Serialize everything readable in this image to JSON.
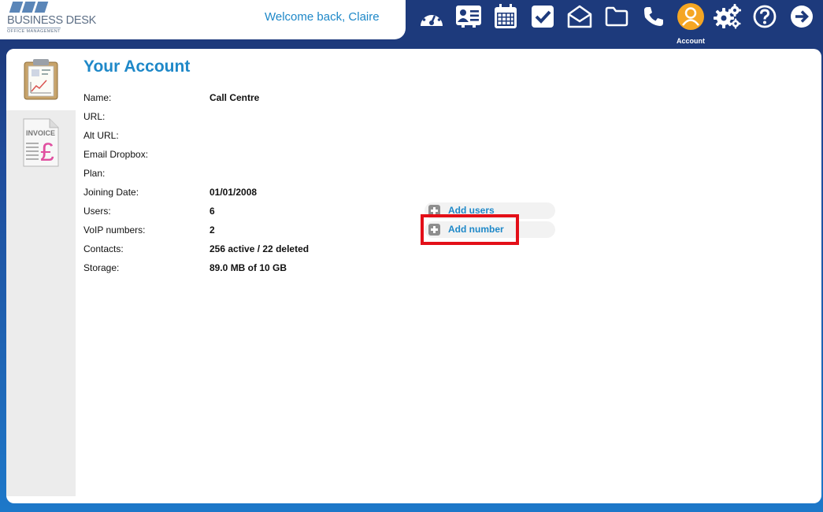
{
  "logo": {
    "name": "BUSINESS DESK",
    "subtitle": "OFFICE MANAGEMENT"
  },
  "header": {
    "welcome": "Welcome back, Claire"
  },
  "nav": {
    "items": [
      {
        "icon": "dashboard-icon"
      },
      {
        "icon": "contacts-card-icon"
      },
      {
        "icon": "calendar-icon"
      },
      {
        "icon": "tasks-check-icon"
      },
      {
        "icon": "mail-envelope-icon"
      },
      {
        "icon": "folder-icon"
      },
      {
        "icon": "phone-icon"
      },
      {
        "icon": "account-user-icon",
        "label": "Account",
        "active": true
      },
      {
        "icon": "settings-gears-icon"
      },
      {
        "icon": "help-icon"
      },
      {
        "icon": "logout-arrow-icon"
      }
    ],
    "active_color": "#f5a623"
  },
  "sidebar": {
    "tabs": [
      {
        "icon": "account-clipboard-icon",
        "active": true
      },
      {
        "icon": "invoice-icon",
        "text": "INVOICE",
        "symbol": "£"
      }
    ]
  },
  "account": {
    "title": "Your Account",
    "rows": [
      {
        "label": "Name:",
        "value": "Call Centre"
      },
      {
        "label": "URL:",
        "value": ""
      },
      {
        "label": "Alt URL:",
        "value": ""
      },
      {
        "label": "Email Dropbox:",
        "value": ""
      },
      {
        "label": "Plan:",
        "value": ""
      },
      {
        "label": "Joining Date:",
        "value": "01/01/2008"
      },
      {
        "label": "Users:",
        "value": "6"
      },
      {
        "label": "VoIP numbers:",
        "value": "2"
      },
      {
        "label": "Contacts:",
        "value": "256 active / 22 deleted"
      },
      {
        "label": "Storage:",
        "value": "89.0 MB of 10 GB"
      }
    ],
    "actions": {
      "add_users": "Add users",
      "add_number": "Add number"
    }
  },
  "colors": {
    "accent": "#1e88c8",
    "header_bg": "#1d3a7c",
    "highlight": "#e30f18"
  }
}
